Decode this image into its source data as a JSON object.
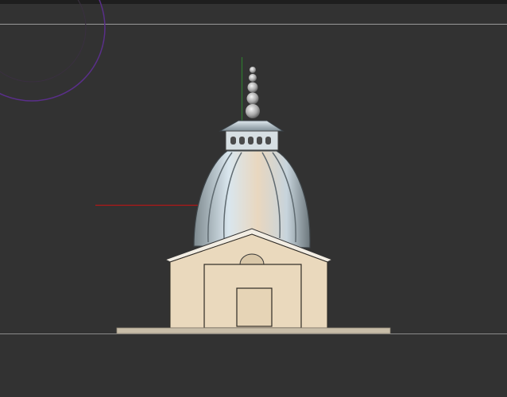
{
  "viewport": {
    "background": "#323232",
    "grid_line_color": "#9a9a9a",
    "axis_x_color": "#b01818",
    "axis_y_color": "#2e7a2e",
    "gizmo_color": "#5a2f8a"
  },
  "model": {
    "wall_color": "#ead9bd",
    "dome_color": "#c9d6df",
    "finial_color": "#b8b8b8"
  }
}
